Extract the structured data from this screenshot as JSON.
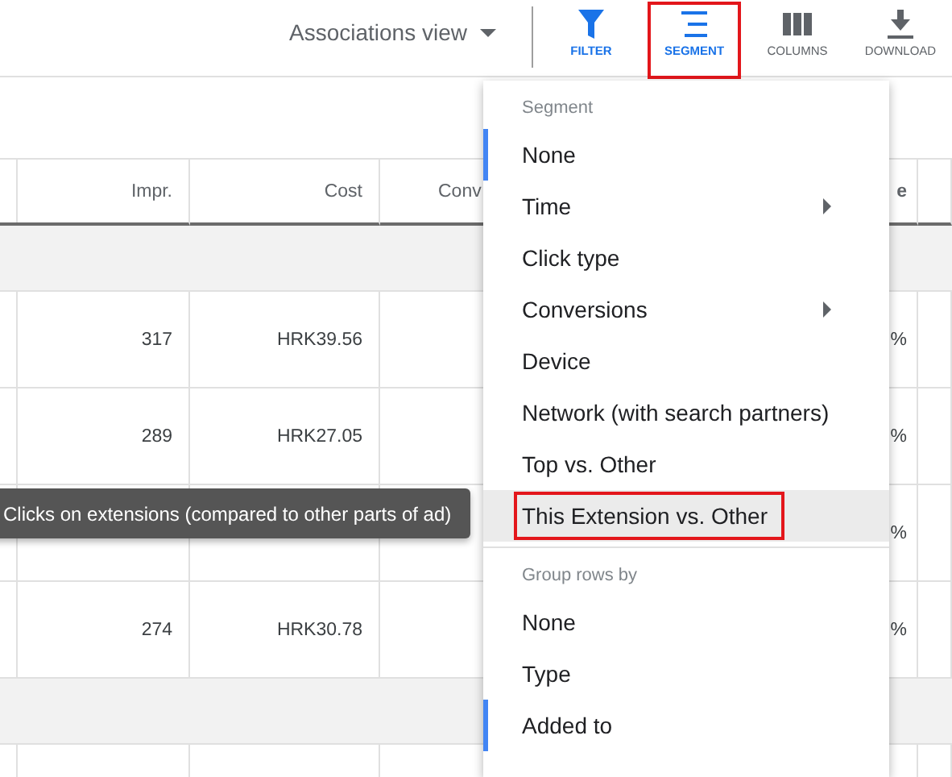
{
  "toolbar": {
    "view_selector": "Associations view",
    "buttons": [
      {
        "label": "FILTER",
        "active": true,
        "annotated": false
      },
      {
        "label": "SEGMENT",
        "active": true,
        "annotated": true
      },
      {
        "label": "COLUMNS",
        "active": false,
        "annotated": false
      },
      {
        "label": "DOWNLOAD",
        "active": false,
        "annotated": false
      }
    ]
  },
  "table": {
    "columns": {
      "column_2": "Impr.",
      "column_3": "Cost",
      "column_4": "Conv",
      "column_6": "e"
    },
    "rows": [
      {
        "kind": "group"
      },
      {
        "kind": "data",
        "impr": "317",
        "cost": "HRK39.56",
        "column_6": "%"
      },
      {
        "kind": "data",
        "impr": "289",
        "cost": "HRK27.05",
        "column_6": "%"
      },
      {
        "kind": "data",
        "column_6": "%"
      },
      {
        "kind": "data",
        "impr": "274",
        "cost": "HRK30.78",
        "column_6": "%"
      },
      {
        "kind": "group"
      },
      {
        "kind": "data"
      }
    ]
  },
  "tooltip": "Clicks on extensions (compared to other parts of ad)",
  "menu": {
    "sections": [
      {
        "heading": "Segment",
        "items": [
          {
            "label": "None",
            "selected": true,
            "has_submenu": false,
            "hovered": false,
            "annotated": false
          },
          {
            "label": "Time",
            "selected": false,
            "has_submenu": true,
            "hovered": false,
            "annotated": false
          },
          {
            "label": "Click type",
            "selected": false,
            "has_submenu": false,
            "hovered": false,
            "annotated": false
          },
          {
            "label": "Conversions",
            "selected": false,
            "has_submenu": true,
            "hovered": false,
            "annotated": false
          },
          {
            "label": "Device",
            "selected": false,
            "has_submenu": false,
            "hovered": false,
            "annotated": false
          },
          {
            "label": "Network (with search partners)",
            "selected": false,
            "has_submenu": false,
            "hovered": false,
            "annotated": false
          },
          {
            "label": "Top vs. Other",
            "selected": false,
            "has_submenu": false,
            "hovered": false,
            "annotated": false
          },
          {
            "label": "This Extension vs. Other",
            "selected": false,
            "has_submenu": false,
            "hovered": true,
            "annotated": true
          }
        ]
      },
      {
        "heading": "Group rows by",
        "items": [
          {
            "label": "None",
            "selected": false,
            "has_submenu": false,
            "hovered": false,
            "annotated": false
          },
          {
            "label": "Type",
            "selected": false,
            "has_submenu": false,
            "hovered": false,
            "annotated": false
          },
          {
            "label": "Added to",
            "selected": true,
            "has_submenu": false,
            "hovered": false,
            "annotated": false
          }
        ]
      }
    ]
  }
}
